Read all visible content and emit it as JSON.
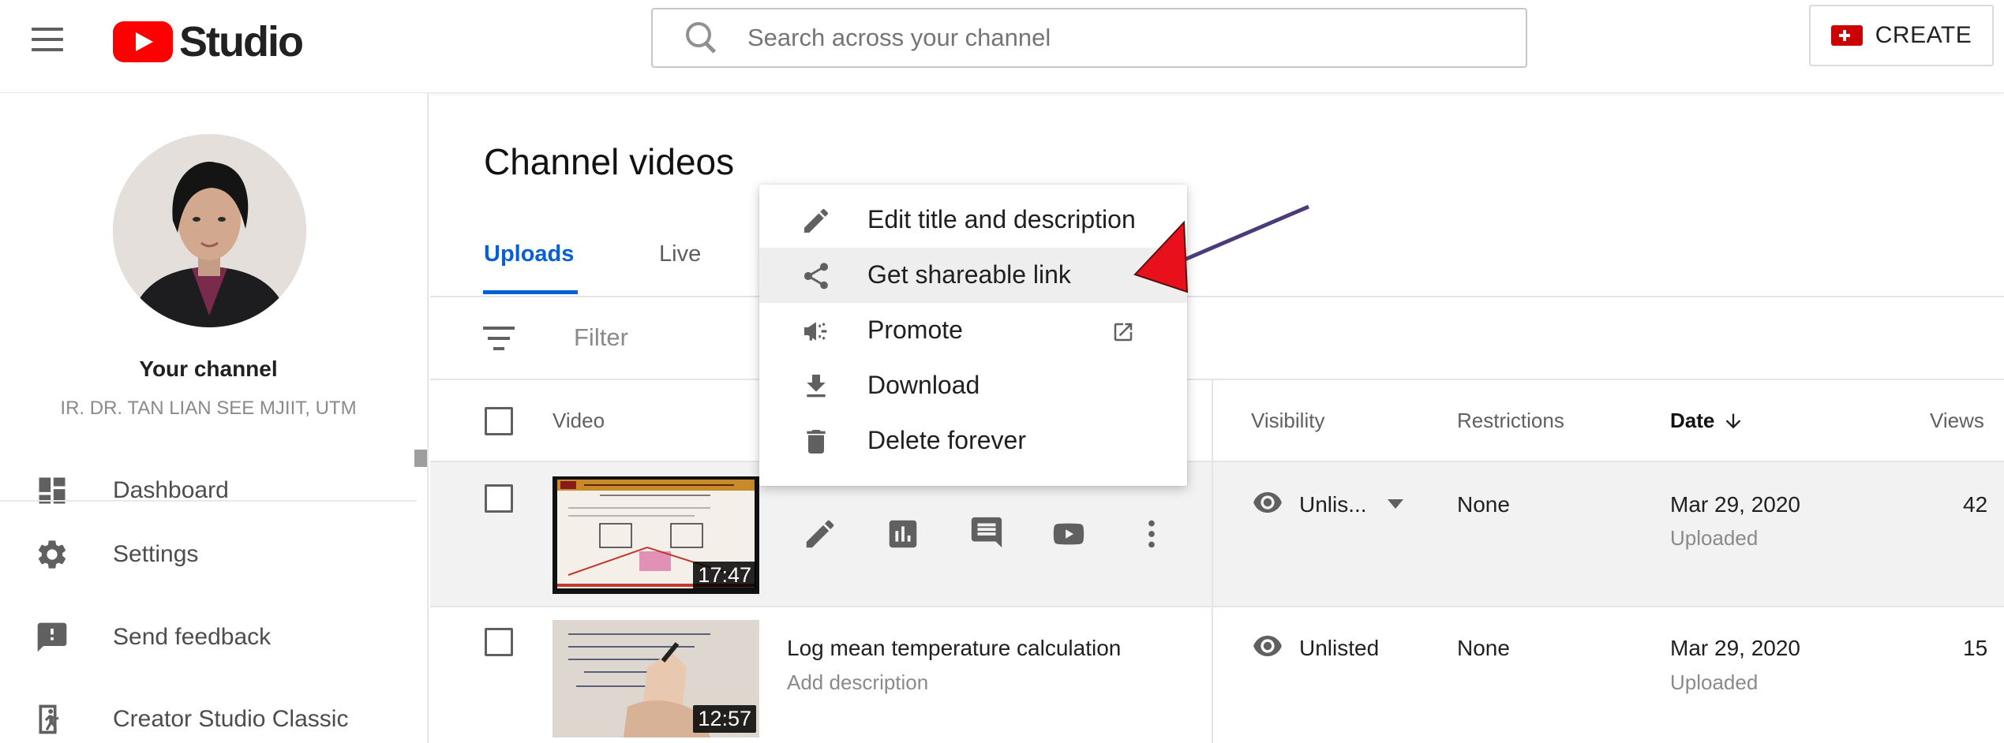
{
  "header": {
    "logo_text": "Studio",
    "search_placeholder": "Search across your channel",
    "create_label": "CREATE"
  },
  "sidebar": {
    "channel_name": "Your channel",
    "channel_subtitle": "IR. DR. TAN LIAN SEE MJIIT, UTM",
    "items": [
      {
        "label": "Dashboard",
        "icon": "dashboard-icon"
      },
      {
        "label": "Settings",
        "icon": "gear-icon"
      },
      {
        "label": "Send feedback",
        "icon": "feedback-icon"
      },
      {
        "label": "Creator Studio Classic",
        "icon": "exit-icon"
      }
    ]
  },
  "main": {
    "title": "Channel videos",
    "tabs": [
      {
        "label": "Uploads",
        "active": true
      },
      {
        "label": "Live",
        "active": false
      }
    ],
    "filter_label": "Filter",
    "columns": {
      "video": "Video",
      "visibility": "Visibility",
      "restrictions": "Restrictions",
      "date": "Date",
      "views": "Views"
    },
    "rows": [
      {
        "title": "",
        "description": "",
        "duration": "17:47",
        "visibility": "Unlis...",
        "restrictions": "None",
        "date": "Mar 29, 2020",
        "date_status": "Uploaded",
        "views": "42"
      },
      {
        "title": "Log mean temperature calculation",
        "description": "Add description",
        "duration": "12:57",
        "visibility": "Unlisted",
        "restrictions": "None",
        "date": "Mar 29, 2020",
        "date_status": "Uploaded",
        "views": "15"
      }
    ]
  },
  "context_menu": {
    "items": [
      {
        "label": "Edit title and description",
        "icon": "pencil-icon"
      },
      {
        "label": "Get shareable link",
        "icon": "share-icon",
        "highlighted": true
      },
      {
        "label": "Promote",
        "icon": "megaphone-icon",
        "trailing_icon": "external-link-icon"
      },
      {
        "label": "Download",
        "icon": "download-icon"
      },
      {
        "label": "Delete forever",
        "icon": "trash-icon"
      }
    ]
  },
  "colors": {
    "brand_red": "#ff0000",
    "accent_blue": "#065fd4",
    "annotation_arrow": "#e8101a"
  }
}
